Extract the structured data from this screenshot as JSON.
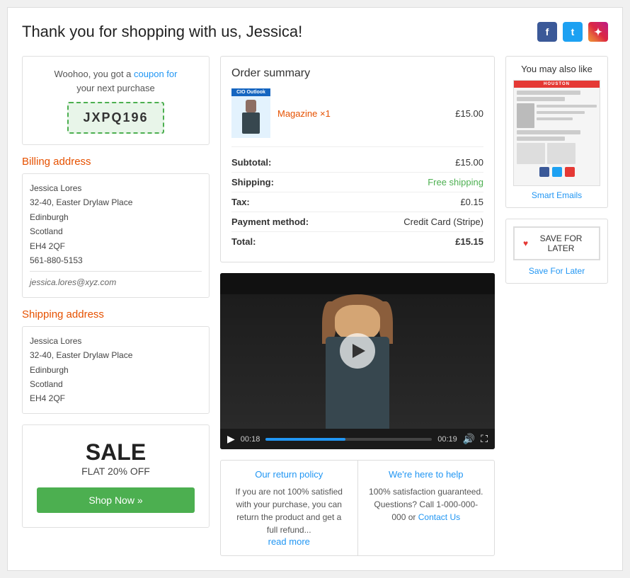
{
  "page": {
    "title": "Thank you for shopping with us, Jessica!"
  },
  "social": {
    "facebook_label": "f",
    "twitter_label": "t",
    "instagram_label": "ig"
  },
  "coupon": {
    "text_line1": "Woohoo, you got a",
    "link_text": "coupon for",
    "text_line2": "your next purchase",
    "code": "JXPQ196"
  },
  "billing": {
    "title": "Billing address",
    "name": "Jessica Lores",
    "address1": "32-40, Easter Drylaw Place",
    "city": "Edinburgh",
    "region": "Scotland",
    "postcode": "EH4 2QF",
    "phone": "561-880-5153",
    "email": "jessica.lores@xyz.com"
  },
  "shipping": {
    "title": "Shipping address",
    "name": "Jessica Lores",
    "address1": "32-40, Easter Drylaw Place",
    "city": "Edinburgh",
    "region": "Scotland",
    "postcode": "EH4 2QF"
  },
  "sale": {
    "title": "SALE",
    "subtitle": "FLAT 20% OFF",
    "button_label": "Shop Now »"
  },
  "order_summary": {
    "title": "Order summary",
    "item_name": "Magazine",
    "item_quantity": "×1",
    "item_price": "£15.00",
    "subtotal_label": "Subtotal:",
    "subtotal_value": "£15.00",
    "shipping_label": "Shipping:",
    "shipping_value": "Free shipping",
    "tax_label": "Tax:",
    "tax_value": "£0.15",
    "payment_label": "Payment method:",
    "payment_value": "Credit Card (Stripe)",
    "total_label": "Total:",
    "total_value": "£15.15"
  },
  "video": {
    "time_current": "00:18",
    "time_total": "00:19",
    "progress_percent": 48
  },
  "policy": {
    "return_title": "Our return policy",
    "return_text": "If you are not 100% satisfied with your purchase, you can return the product and get a full refund...",
    "return_link": "read more",
    "help_title": "We're here to help",
    "help_text": "100% satisfaction guaranteed. Questions? Call 1-000-000-000 or",
    "help_link": "Contact Us"
  },
  "you_may_like": {
    "title": "You may also like",
    "product_name": "Smart Emails",
    "thumb_header": "HOUSTON"
  },
  "save_for_later": {
    "button_label": "SAVE FOR LATER",
    "link_label": "Save For Later"
  }
}
